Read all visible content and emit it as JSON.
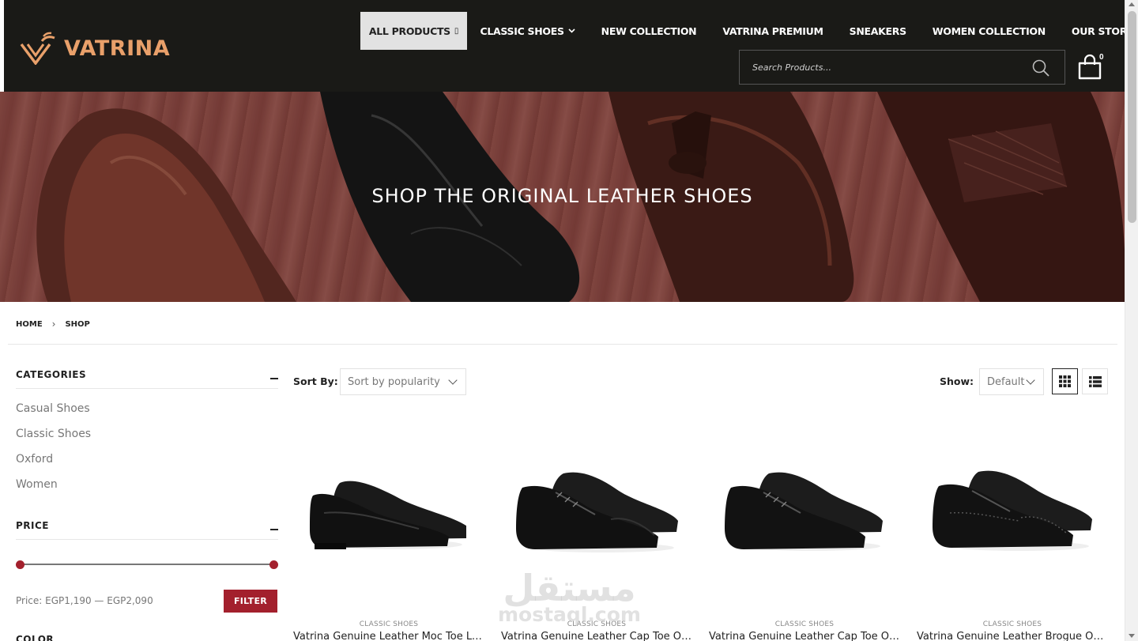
{
  "brand": {
    "name": "VATRINA",
    "accent": "#e9a06a",
    "dark": "#1a1a17",
    "primary": "#a3202d"
  },
  "nav": {
    "items": [
      {
        "label": "ALL PRODUCTS",
        "suffix": "▯",
        "active": true
      },
      {
        "label": "CLASSIC SHOES",
        "suffix": "⌄"
      },
      {
        "label": "NEW COLLECTION"
      },
      {
        "label": "VATRINA PREMIUM"
      },
      {
        "label": "SNEAKERS"
      },
      {
        "label": "WOMEN COLLECTION"
      },
      {
        "label": "OUR STORES"
      }
    ]
  },
  "search": {
    "placeholder": "Search Products...",
    "icon": "search-icon"
  },
  "cart": {
    "count": "0",
    "icon": "shopping-bag-icon"
  },
  "hero": {
    "title": "SHOP THE ORIGINAL LEATHER SHOES"
  },
  "breadcrumb": {
    "home": "HOME",
    "separator": "›",
    "current": "SHOP"
  },
  "sidebar": {
    "categories_title": "CATEGORIES",
    "categories": [
      "Casual Shoes",
      "Classic Shoes",
      "Oxford",
      "Women"
    ],
    "price_title": "PRICE",
    "price_range_text": "Price: EGP1,190 — EGP2,090",
    "price_min": 1190,
    "price_max": 2090,
    "filter_label": "FILTER",
    "color_title": "COLOR"
  },
  "toolbar": {
    "sort_label": "Sort By:",
    "sort_value": "Sort by popularity",
    "show_label": "Show:",
    "show_value": "Default",
    "view_mode": "grid"
  },
  "products": [
    {
      "category": "CLASSIC SHOES",
      "name": "Vatrina Genuine Leather Moc Toe Loafer",
      "style": "loafer"
    },
    {
      "category": "CLASSIC SHOES",
      "name": "Vatrina Genuine Leather Cap Toe Oxford",
      "style": "captoe"
    },
    {
      "category": "CLASSIC SHOES",
      "name": "Vatrina Genuine Leather Cap Toe Oxford Plain",
      "style": "oxford"
    },
    {
      "category": "CLASSIC SHOES",
      "name": "Vatrina Genuine Leather Brogue Oxford",
      "style": "brogue"
    }
  ],
  "watermark": {
    "arabic": "مستقل",
    "latin": "mostaql.com"
  }
}
